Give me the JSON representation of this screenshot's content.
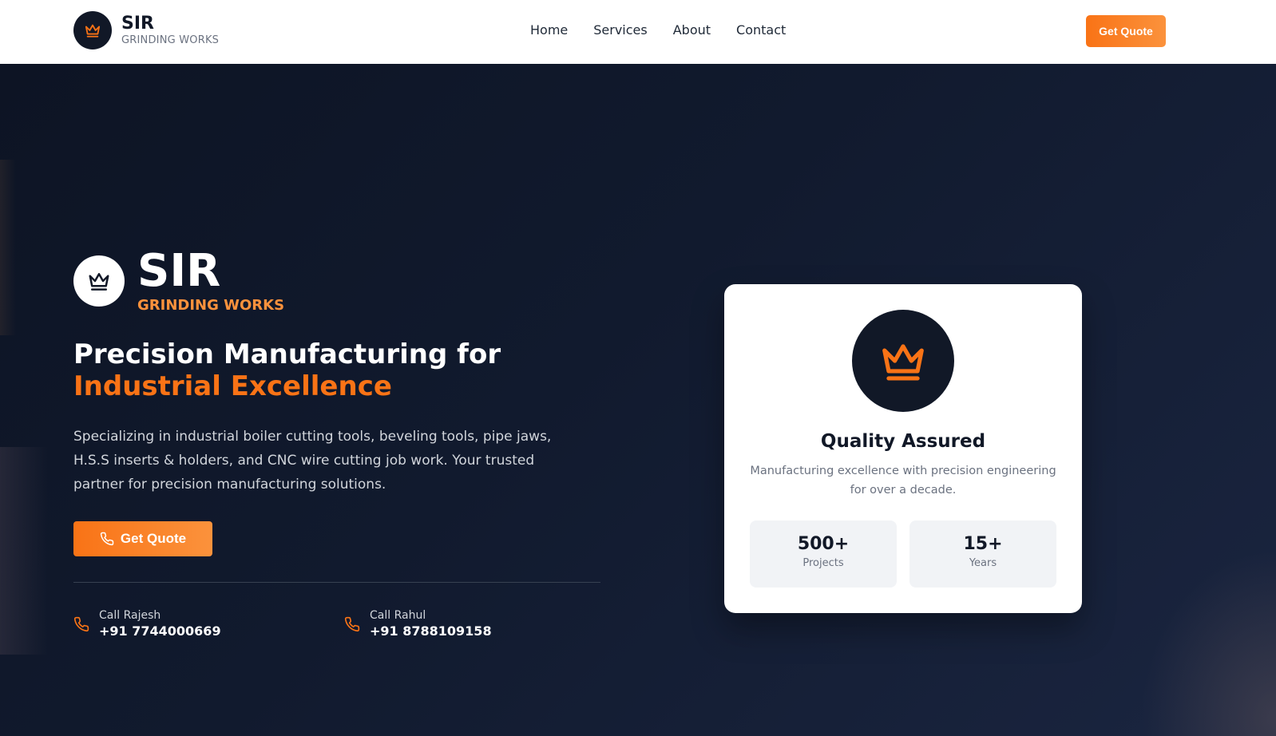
{
  "header": {
    "logo_title": "SIR",
    "logo_subtitle": "GRINDING WORKS",
    "logo_icon": "crown-icon",
    "nav": [
      {
        "label": "Home"
      },
      {
        "label": "Services"
      },
      {
        "label": "About"
      },
      {
        "label": "Contact"
      }
    ],
    "cta_label": "Get Quote"
  },
  "hero": {
    "brand_title": "SIR",
    "brand_subtitle": "GRINDING WORKS",
    "brand_icon": "crown-icon",
    "headline_main": "Precision Manufacturing for ",
    "headline_accent": "Industrial Excellence",
    "description": "Specializing in industrial boiler cutting tools, beveling tools, pipe jaws, H.S.S inserts & holders, and CNC wire cutting job work. Your trusted partner for precision manufacturing solutions.",
    "cta_label": "Get Quote",
    "cta_icon": "phone-icon",
    "contacts": [
      {
        "label": "Call Rajesh",
        "phone": "+91 7744000669",
        "icon": "phone-icon"
      },
      {
        "label": "Call Rahul",
        "phone": "+91 8788109158",
        "icon": "phone-icon"
      }
    ]
  },
  "card": {
    "icon": "crown-icon",
    "title": "Quality Assured",
    "text": "Manufacturing excellence with precision engineering for over a decade.",
    "stats": [
      {
        "value": "500+",
        "label": "Projects"
      },
      {
        "value": "15+",
        "label": "Years"
      }
    ]
  },
  "colors": {
    "accent": "#f97316",
    "dark": "#111827",
    "hero_bg": "#0f172a"
  }
}
